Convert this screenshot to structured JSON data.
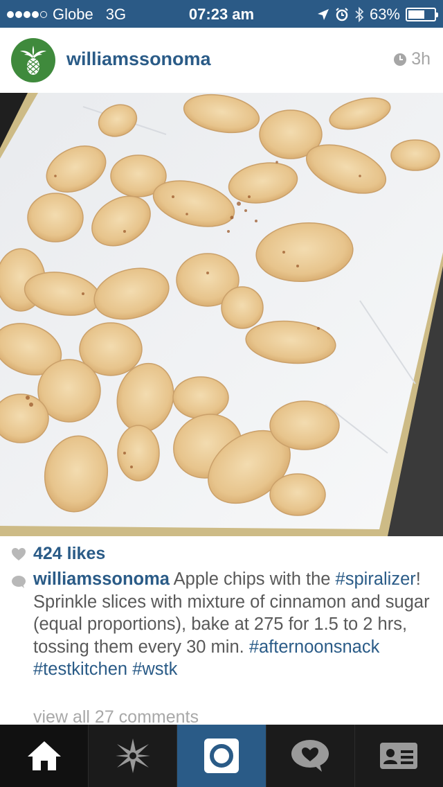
{
  "status_bar": {
    "carrier": "Globe",
    "network": "3G",
    "time": "07:23 am",
    "battery": "63%",
    "battery_level": 0.63
  },
  "post": {
    "username": "williamssonoma",
    "time_ago": "3h",
    "likes": "424 likes",
    "caption": {
      "username": "williamssonoma",
      "text_1": " Apple chips with the ",
      "tag_1": "#spiralizer",
      "text_2": "! Sprinkle slices with mixture of cinnamon and sugar (equal proportions), bake at 275 for 1.5 to 2 hrs, tossing them every 30 min. ",
      "tag_2": "#afternoonsnack",
      "tag_3": "#testkitchen",
      "tag_4": "#wstk"
    },
    "view_comments": "view all 27 comments"
  },
  "tab_bar": {
    "items": [
      {
        "icon": "home-icon",
        "active": false
      },
      {
        "icon": "explore-icon",
        "active": false
      },
      {
        "icon": "camera-icon",
        "active": true
      },
      {
        "icon": "activity-icon",
        "active": false
      },
      {
        "icon": "profile-icon",
        "active": false
      }
    ]
  },
  "colors": {
    "status_bar": "#2b5a86",
    "accent": "#2a5b87",
    "tab_bar": "#1b1b1b",
    "avatar": "#3f8a3c"
  }
}
